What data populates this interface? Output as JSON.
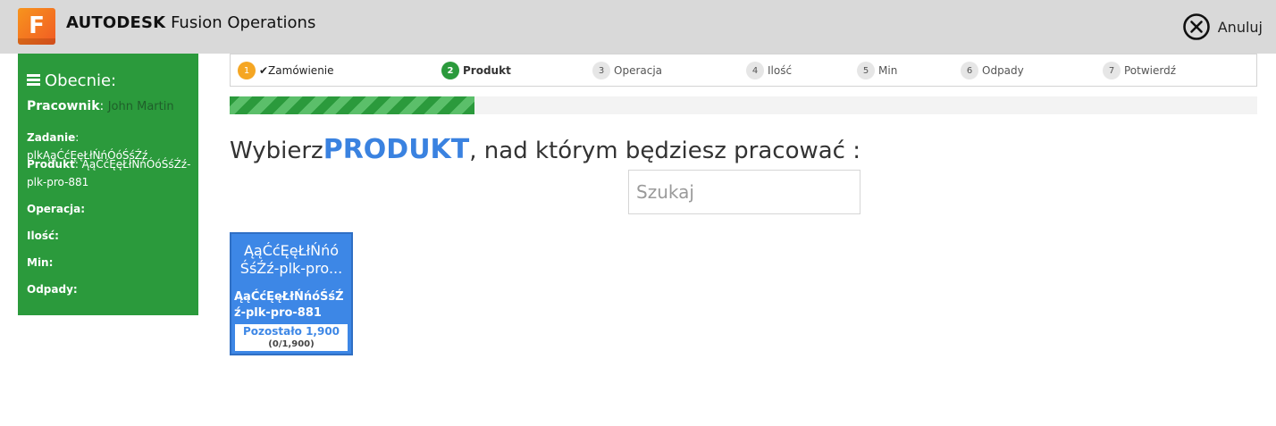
{
  "header": {
    "logo_letter": "F",
    "brand_bold": "AUTODESK",
    "brand_rest": "Fusion Operations",
    "cancel_label": "Anuluj",
    "colors": {
      "bar": "#d9d9d9",
      "logo": "#f47b20"
    }
  },
  "sidebar": {
    "title": "Obecnie:",
    "worker_label": "Pracownik",
    "worker_value": "John Martin",
    "task_label": "Zadanie",
    "task_value": "plkĄąĆćĘęŁłŃńÓóŚśŹź",
    "product_label": "Produkt",
    "product_value": "ĄąĆćĘęŁłŃńÓóŚśŹź-plk-pro-881",
    "operation_label": "Operacja:",
    "quantity_label": "Ilość:",
    "min_label": "Min:",
    "waste_label": "Odpady:",
    "color": "#2b9a3c"
  },
  "steps": [
    {
      "num": "1",
      "label": "✔Zamówienie",
      "state": "done"
    },
    {
      "num": "2",
      "label": "Produkt",
      "state": "active"
    },
    {
      "num": "3",
      "label": "Operacja",
      "state": "pending"
    },
    {
      "num": "4",
      "label": "Ilość",
      "state": "pending"
    },
    {
      "num": "5",
      "label": "Min",
      "state": "pending"
    },
    {
      "num": "6",
      "label": "Odpady",
      "state": "pending"
    },
    {
      "num": "7",
      "label": "Potwierdź",
      "state": "pending"
    }
  ],
  "progress": {
    "fraction": 0.238
  },
  "prompt": {
    "prefix": "Wybierz",
    "emphasis": "PRODUKT",
    "suffix": ", nad którym będziesz pracować :"
  },
  "search": {
    "placeholder": "Szukaj",
    "value": ""
  },
  "products": [
    {
      "title": "ĄąĆćĘęŁłŃńó ŚśŹź-plk-pro...",
      "code": "ĄąĆćĘęŁłŃńóŚśŹź-plk-pro-881",
      "remaining": "Pozostało 1,900",
      "ratio": "(0/1,900)"
    }
  ]
}
